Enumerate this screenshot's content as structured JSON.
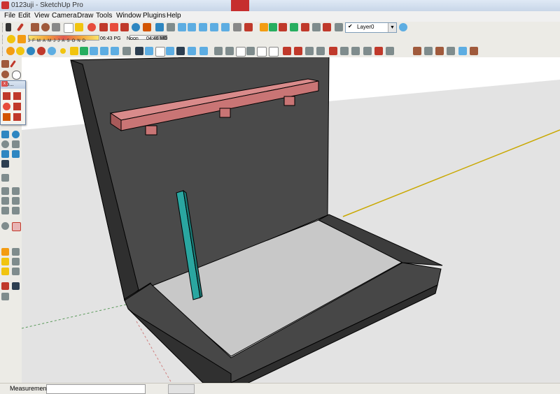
{
  "window": {
    "title": "0123uji - SketchUp Pro"
  },
  "menu": [
    "File",
    "Edit",
    "View",
    "Camera",
    "Draw",
    "Tools",
    "Window",
    "Plugins",
    "Help"
  ],
  "shadow": {
    "months": "JFMAMJJASOND",
    "time_start": "06:43 PG",
    "noon": "Noon",
    "time_end": "04:46 MD"
  },
  "layers": {
    "current": "Layer0",
    "check": "✔",
    "arrow": "▼"
  },
  "floating_toolbar": {
    "title": "Mo...",
    "close": "x"
  },
  "status": {
    "measurements_label": "Measurements"
  },
  "colors": {
    "dark_face": "#4b4b4b",
    "side_face": "#3a3a3a",
    "floor": "#c8c8c8",
    "beam": "#c97575",
    "post": "#2aa6a0",
    "ground": "#e3e3e3",
    "sky": "#ffffff",
    "axis_green": "#1d7a1d",
    "axis_yellow": "#c9a800"
  }
}
